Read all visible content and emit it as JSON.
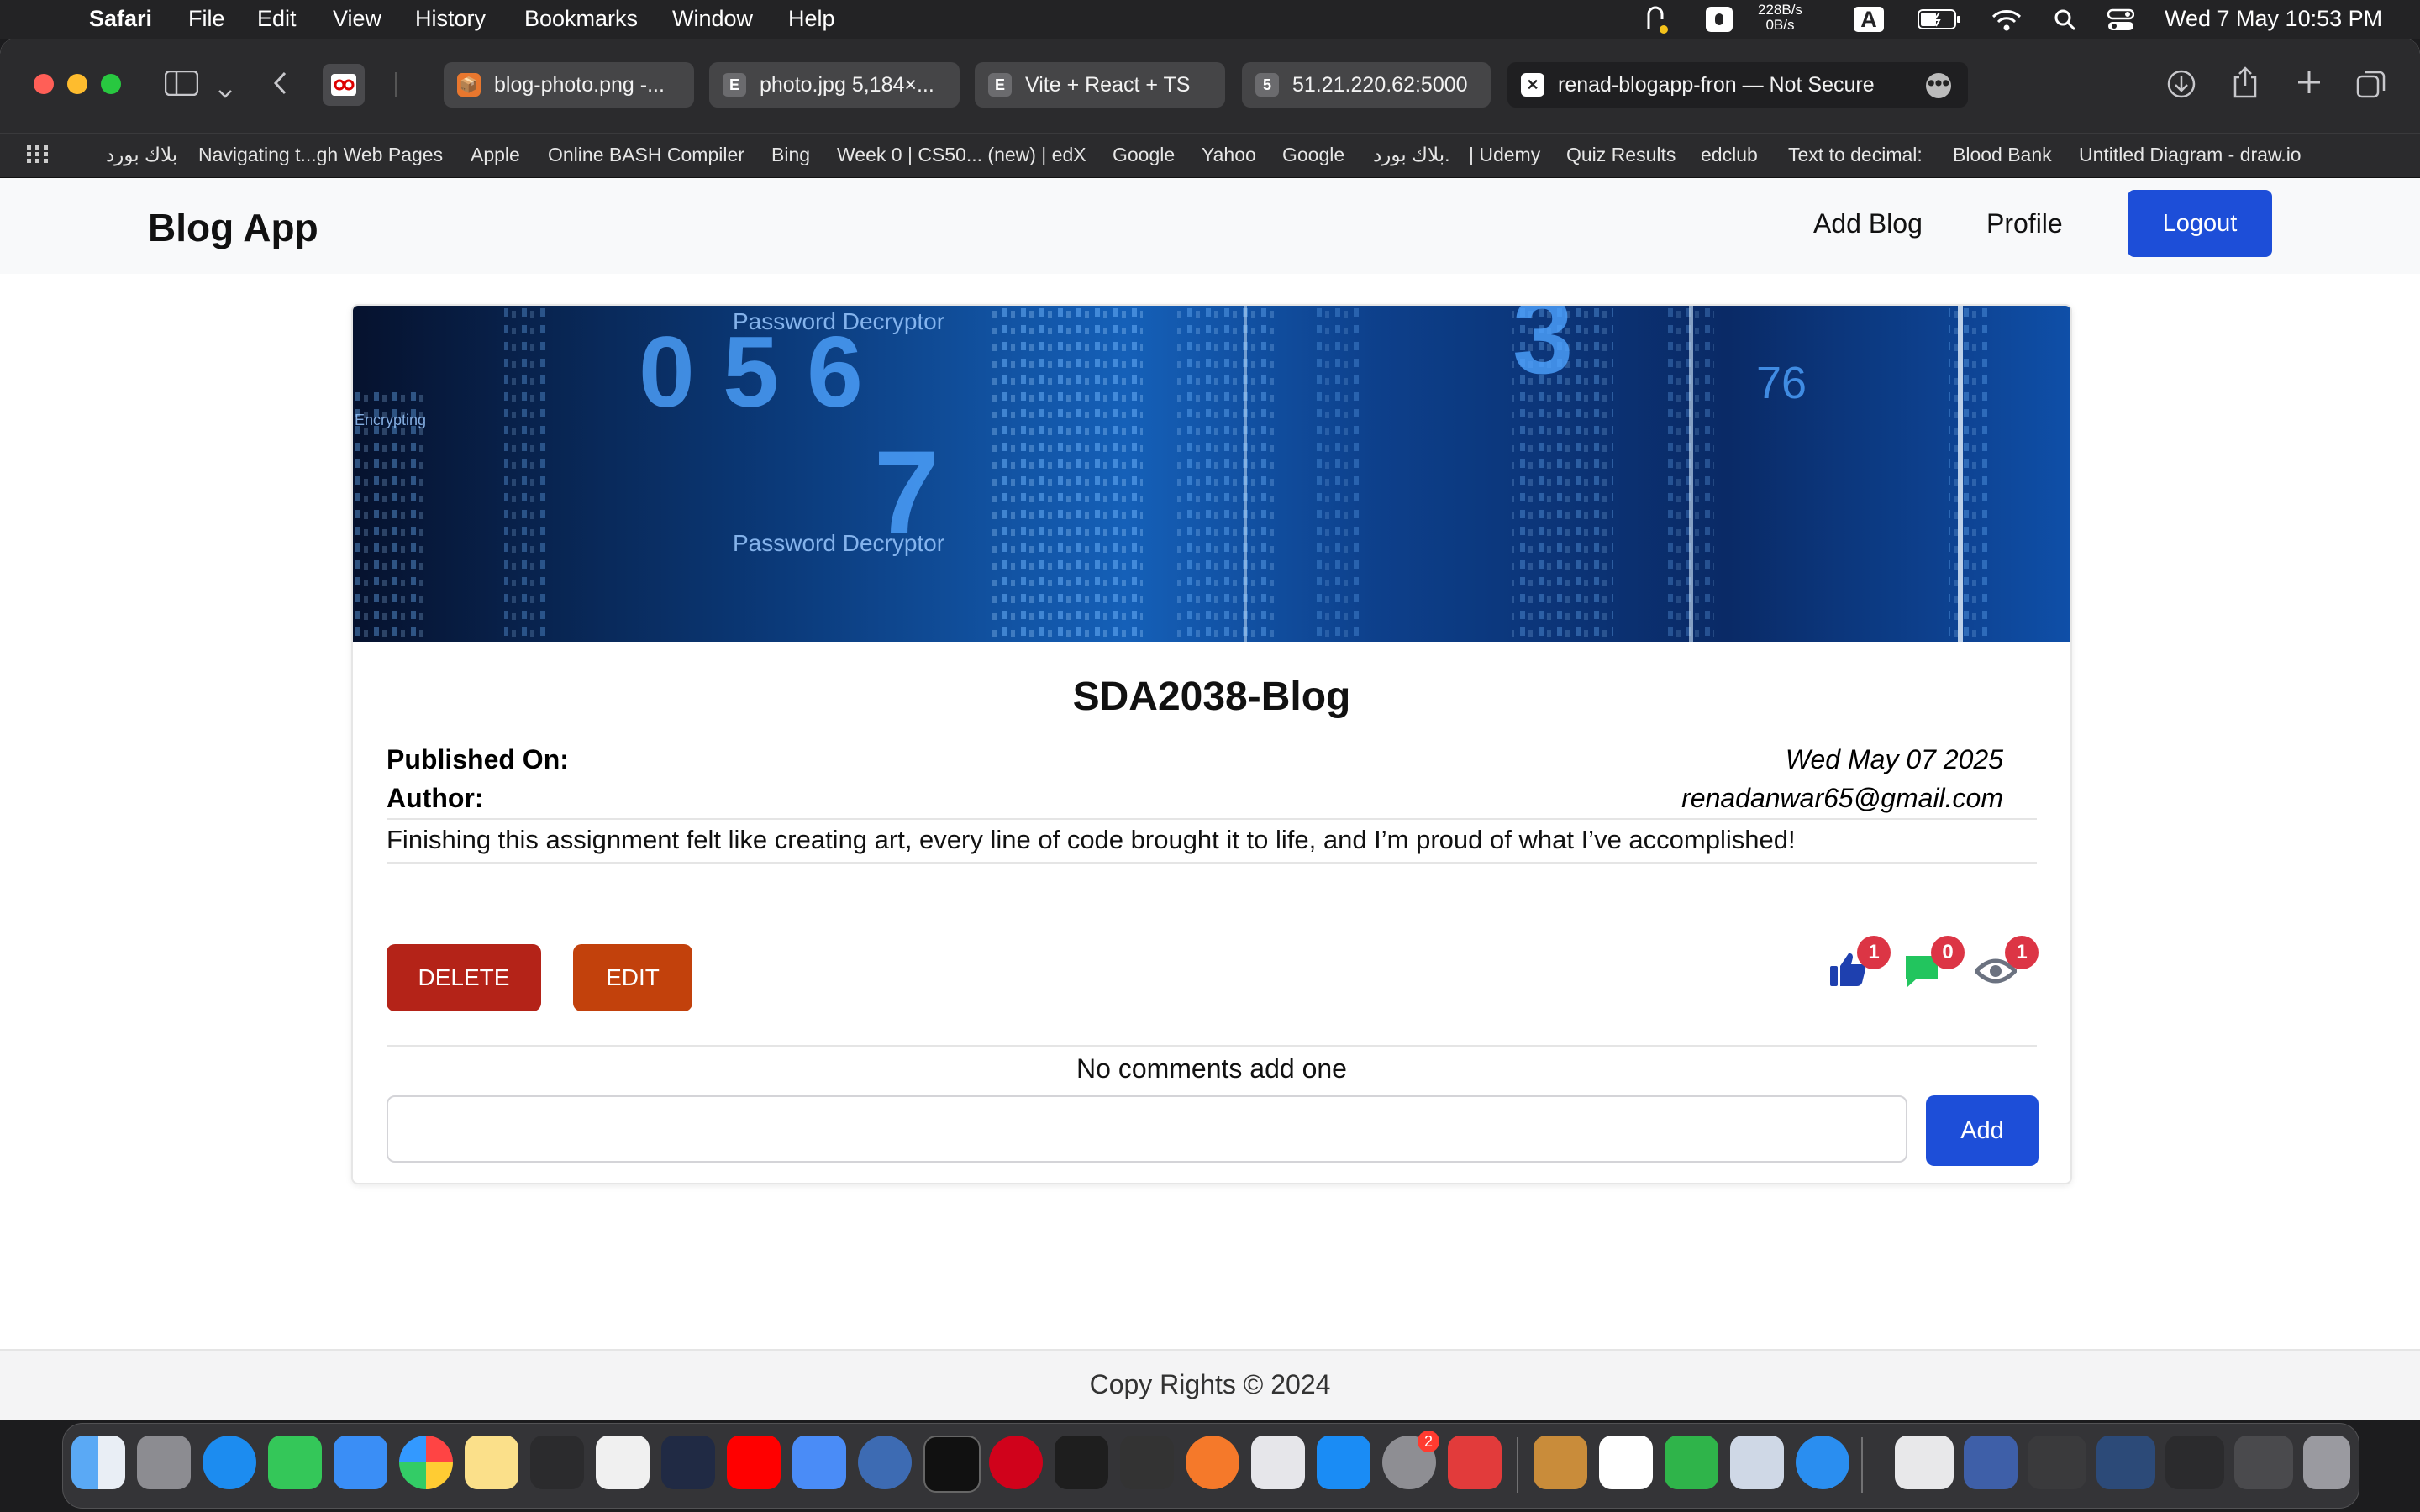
{
  "menubar": {
    "app": "Safari",
    "menus": [
      "File",
      "Edit",
      "View",
      "History",
      "Bookmarks",
      "Window",
      "Help"
    ],
    "net_up": "228B/s",
    "net_down": "0B/s",
    "input_source": "A",
    "datetime": "Wed 7 May  10:53 PM"
  },
  "browser": {
    "tabs": [
      {
        "label": "blog-photo.png -...",
        "favicon": "📦"
      },
      {
        "label": "photo.jpg 5,184×...",
        "favicon": "E"
      },
      {
        "label": "Vite + React + TS",
        "favicon": "E"
      },
      {
        "label": "51.21.220.62:5000",
        "favicon": "5"
      },
      {
        "label": "renad-blogapp-fron — Not Secure",
        "favicon": "✕"
      }
    ],
    "bookmarks": [
      "بلاك بورد",
      "Navigating t...gh Web Pages",
      "Apple",
      "Online BASH Compiler",
      "Bing",
      "Week 0 | CS50... (new) | edX",
      "Google",
      "Yahoo",
      "Google",
      "بلاك بورد.",
      "| Udemy",
      "Quiz Results",
      "edclub",
      "Text to decimal:",
      "Blood Bank",
      "Untitled Diagram - draw.io"
    ]
  },
  "navbar": {
    "brand": "Blog App",
    "add_blog": "Add Blog",
    "profile": "Profile",
    "logout": "Logout"
  },
  "post": {
    "title": "SDA2038-Blog",
    "published_label": "Published On:",
    "published_value": "Wed May 07 2025",
    "author_label": "Author:",
    "author_value": "renadanwar65@gmail.com",
    "body": "Finishing this assignment felt like creating art, every line of code brought it to life, and I’m proud of what I’ve accomplished!",
    "delete_label": "DELETE",
    "edit_label": "EDIT",
    "likes": "1",
    "comments": "0",
    "views": "1",
    "banner_texts": [
      "Password Decryptor",
      "Password Decryptor",
      "Encrypting",
      "0 5 6",
      "7",
      "3",
      "76"
    ]
  },
  "comments": {
    "empty_text": "No comments add one",
    "input_value": "",
    "add_label": "Add"
  },
  "footer": {
    "text": "Copy Rights © 2024"
  },
  "colors": {
    "primary": "#1d4ed8",
    "delete": "#b42318",
    "edit": "#c2410c",
    "badge": "#dc3545",
    "like": "#1e40af",
    "comment": "#22c55e",
    "view": "#6b7280"
  },
  "dock": {
    "settings_badge": "2"
  }
}
